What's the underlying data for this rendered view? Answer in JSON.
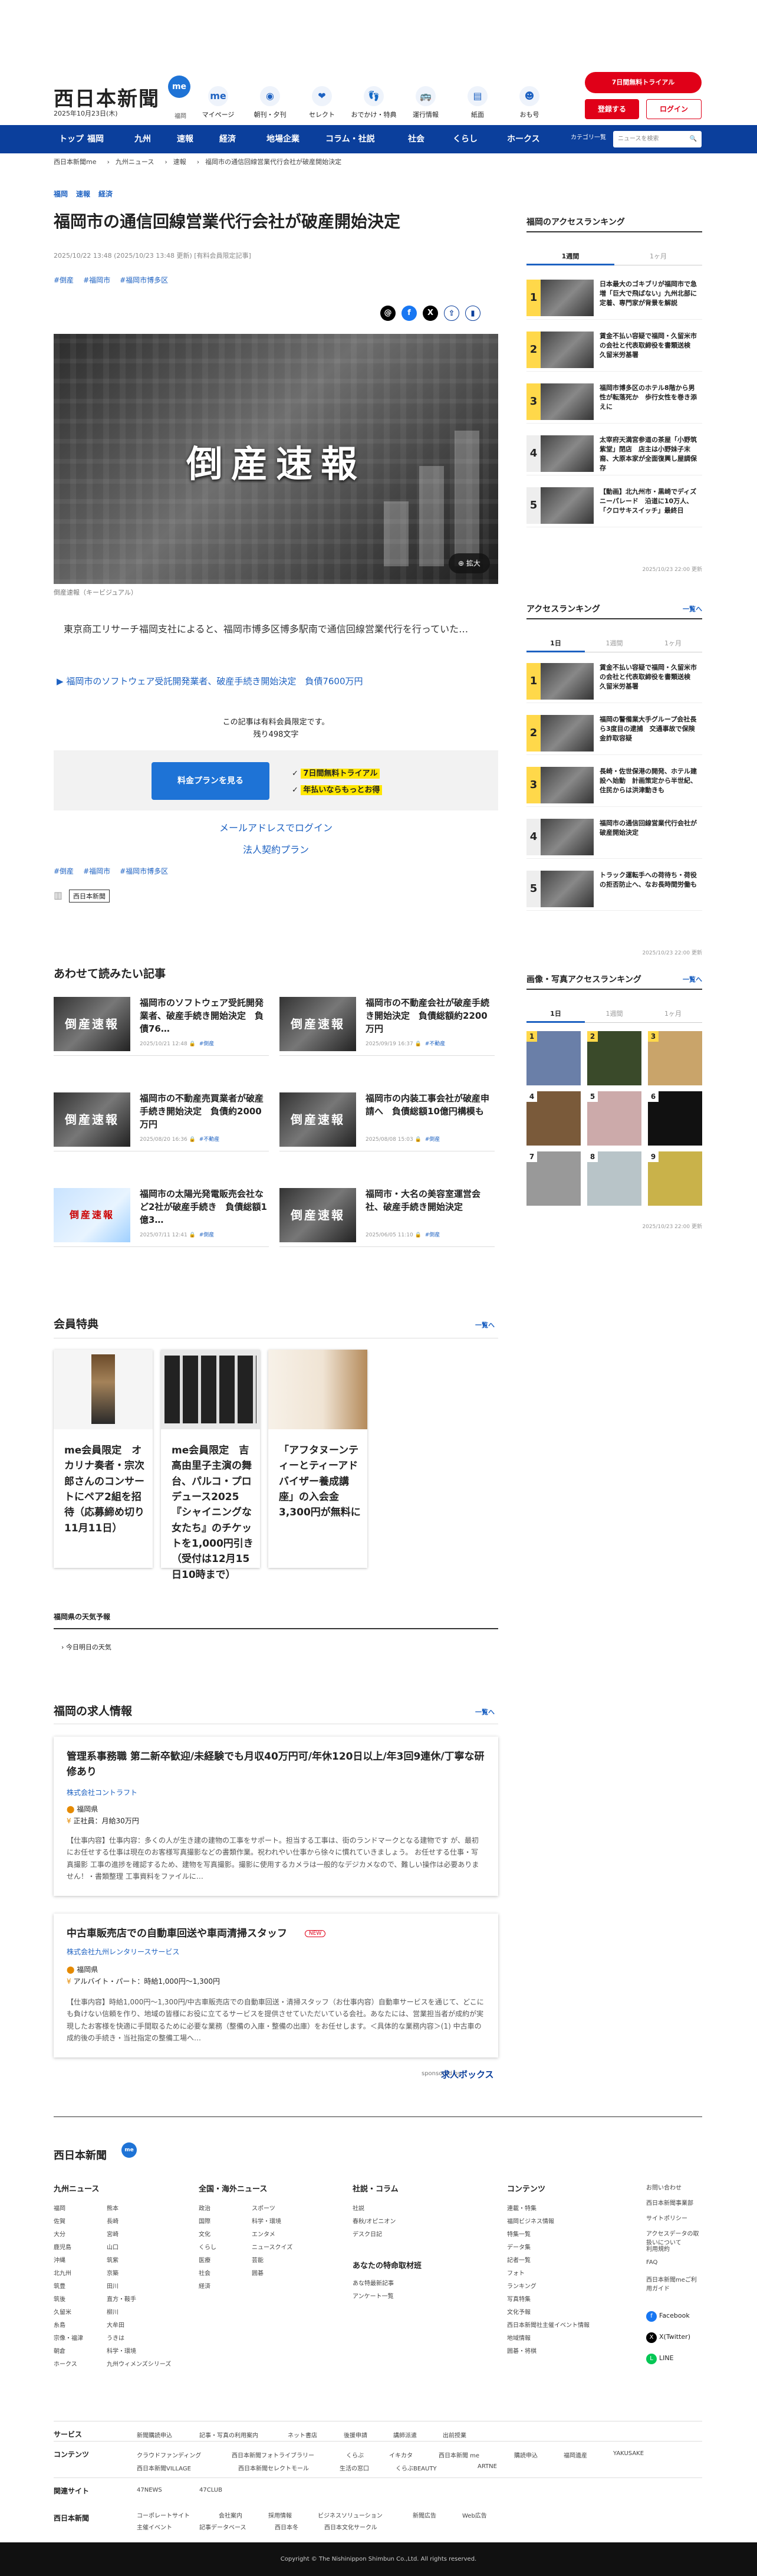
{
  "header": {
    "logo": "西日本新聞",
    "logo_me": "me",
    "date": "2025年10月23日(木)",
    "region": "福岡",
    "nav": [
      {
        "label": "マイページ",
        "icon": "me"
      },
      {
        "label": "朝刊・夕刊",
        "icon": "◉"
      },
      {
        "label": "セレクト",
        "icon": "❤"
      },
      {
        "label": "おでかけ・特典",
        "icon": "👣"
      },
      {
        "label": "運行情報",
        "icon": "🚌"
      },
      {
        "label": "紙面",
        "icon": "▤"
      },
      {
        "label": "おも号",
        "icon": "☻"
      }
    ],
    "trial": "7日間無料トライアル",
    "register": "登録する",
    "login": "ログイン"
  },
  "navbar": {
    "items": [
      "トップ",
      "福岡",
      "九州",
      "速報",
      "経済",
      "地場企業",
      "コラム・社説",
      "社会",
      "くらし",
      "ホークス"
    ],
    "category": "カテゴリ一覧",
    "search_placeholder": "ニュースを検索",
    "search_icon": "🔍"
  },
  "breadcrumb": [
    "西日本新聞me",
    "九州ニュース",
    "速報",
    "福岡市の通信回線営業代行会社が破産開始決定"
  ],
  "article": {
    "top_tags": [
      "福岡",
      "速報",
      "経済"
    ],
    "title": "福岡市の通信回線営業代行会社が破産開始決定",
    "dateline": "2025/10/22 13:48 (2025/10/23 13:48 更新) [有料会員限定記事]",
    "hashtags": [
      "#倒産",
      "#福岡市",
      "#福岡市博多区"
    ],
    "share": [
      {
        "name": "threads",
        "g": "@"
      },
      {
        "name": "facebook",
        "g": "f"
      },
      {
        "name": "x",
        "g": "X"
      },
      {
        "name": "share",
        "g": "⇪"
      },
      {
        "name": "bookmark",
        "g": "▮"
      }
    ],
    "hero_text": "倒産速報",
    "zoom": "拡大",
    "caption": "倒産速報（キービジュアル）",
    "lead": "東京商工リサーチ福岡支社によると、福岡市博多区博多駅南で通信回線営業代行を行っていた…",
    "related_link": "福岡市のソフトウェア受託開発業者、破産手続き開始決定　負債7600万円",
    "members_only": "この記事は有料会員限定です。",
    "remaining": "残り498文字",
    "plan_button": "料金プランを見る",
    "perks": [
      "7日間無料トライアル",
      "年払いならもっとお得"
    ],
    "email_login": "メールアドレスでログイン",
    "corp_plan": "法人契約プラン",
    "bottom_hashtags": [
      "#倒産",
      "#福岡市",
      "#福岡市博多区"
    ],
    "publisher": "西日本新聞"
  },
  "read_also": {
    "heading": "あわせて読みたい記事",
    "items": [
      {
        "title": "福岡市のソフトウェア受託開発業者、破産手続き開始決定　負債76…",
        "date": "2025/10/21 12:48",
        "tag": "#倒産",
        "thumb": "倒産速報"
      },
      {
        "title": "福岡市の不動産会社が破産手続き開始決定　負債総額約2200万円",
        "date": "2025/09/19 16:37",
        "tag": "#不動産",
        "thumb": "倒産速報"
      },
      {
        "title": "福岡市の不動産売買業者が破産手続き開始決定　負債約2000万円",
        "date": "2025/08/20 16:36",
        "tag": "#不動産",
        "thumb": "倒産速報"
      },
      {
        "title": "福岡市の内装工事会社が破産申請へ　負債総額10億円構模も",
        "date": "2025/08/08 15:03",
        "tag": "#倒産",
        "thumb": "倒産速報"
      },
      {
        "title": "福岡市の太陽光発電販売会社など2社が破産手続き　負債総額1億3…",
        "date": "2025/07/11 12:41",
        "tag": "#倒産",
        "thumb": "倒産速報"
      },
      {
        "title": "福岡市・大名の美容室運営会社、破産手続き開始決定",
        "date": "2025/06/05 11:10",
        "tag": "#倒産",
        "thumb": "倒産速報"
      }
    ]
  },
  "member_perks": {
    "heading": "会員特典",
    "more": "一覧へ",
    "items": [
      {
        "title": "me会員限定　オカリナ奏者・宗次郎さんのコンサートにペア2組を招待（応募締め切り11月11日）"
      },
      {
        "title": "me会員限定　吉高由里子主演の舞台、パルコ・プロデュース2025『シャイニングな女たち』のチケットを1,000円引き（受付は12月15日10時まで）"
      },
      {
        "title": "「アフタヌーンティーとティーアドバイザー養成講座」の入会金3,300円が無料に"
      }
    ]
  },
  "weather": {
    "heading": "福岡県の天気予報",
    "tab": "今日明日の天気"
  },
  "jobs": {
    "heading": "福岡の求人情報",
    "more": "一覧へ",
    "items": [
      {
        "title": "管理系事務職 第二新卒歓迎/未経験でも月収40万円可/年休120日以上/年3回9連休/丁寧な研修あり",
        "company": "株式会社コントラフト",
        "location": "福岡県",
        "salary": "正社員：月給30万円",
        "desc": "【仕事内容】仕事内容：多くの人が生き建の建物の工事をサポート。担当する工事は、街のランドマークとなる建物です が、最初にお任せする仕事は現在のお客様写真撮影などの書類作業。祝われやい仕事から徐々に慣れていきましょう。 お任せする仕事・写真撮影 工事の進捗を確認するため、建物を写真撮影。撮影に使用するカメラは一般的なデジカメなので、難しい操作は必要ありません！・書類整理 工事資料をファイルに…"
      },
      {
        "title": "中古車販売店での自動車回送や車両清掃スタッフ",
        "new": "NEW",
        "company": "株式会社九州レンタリースサービス",
        "location": "福岡県",
        "salary": "アルバイト・パート：時給1,000円〜1,300円",
        "desc": "【仕事内容】時給1,000円〜1,300円/中古車販売店での自動車回送・清掃スタッフ（お仕事内容）自動車サービスを通じて、どこにも負けない信頼を作り、地域の皆様にお役に立てるサービスを提供させていただいている会社。あなたには、営業担当者が成約が実現したお客様を快適に手間取るために必要な業務（整備の入庫・整備の出庫）をお任せします。＜具体的な業務内容＞(1) 中古車の成約後の手続き・当社指定の整備工場へ…"
      }
    ],
    "powered": "sponsored by",
    "kyujin": "求人ボックス"
  },
  "sidebar": {
    "access_ranking_fukuoka": {
      "heading": "福岡のアクセスランキング",
      "tabs": [
        "1週間",
        "1ヶ月"
      ],
      "items": [
        {
          "rank": "1",
          "title": "日本最大のゴキブリが福岡市で急増「巨大で飛ばない」九州北部に定着、専門家が背景を解説"
        },
        {
          "rank": "2",
          "title": "賃金不払い容疑で福岡・久留米市の会社と代表取締役を書類送検　久留米労基署"
        },
        {
          "rank": "3",
          "title": "福岡市博多区のホテル8階から男性が転落死か　歩行女性を巻き添えに"
        },
        {
          "rank": "4",
          "title": "太宰府天満宮参道の茶屋「小野筑紫堂」閉店　店主は小野妹子末裔、大原本家が全面復興し屋調保存"
        },
        {
          "rank": "5",
          "title": "【動画】北九州市・黒崎でディズニーパレード　沿道に10万人、「クロサキスイッチ」最終日"
        }
      ],
      "updated": "2025/10/23 22:00 更新"
    },
    "access_ranking": {
      "heading": "アクセスランキング",
      "more": "一覧へ",
      "tabs": [
        "1日",
        "1週間",
        "1ヶ月"
      ],
      "items": [
        {
          "rank": "1",
          "title": "賃金不払い容疑で福岡・久留米市の会社と代表取締役を書類送検　久留米労基署"
        },
        {
          "rank": "2",
          "title": "福岡の警備業大手グループ会社長ら3度目の逮捕　交通事故で保険金詐取容疑"
        },
        {
          "rank": "3",
          "title": "長崎・佐世保港の開発、ホテル建設へ始動　計画策定から半世紀、住民からは洪津動きも"
        },
        {
          "rank": "4",
          "title": "福岡市の通信回線営業代行会社が破産開始決定"
        },
        {
          "rank": "5",
          "title": "トラック運転手への荷待ち・荷役の拒否防止へ、なお長時間労働も"
        }
      ],
      "updated": "2025/10/23 22:00 更新"
    },
    "photo_ranking": {
      "heading": "画像・写真アクセスランキング",
      "more": "一覧へ",
      "tabs": [
        "1日",
        "1週間",
        "1ヶ月"
      ],
      "ranks": [
        "1",
        "2",
        "3",
        "4",
        "5",
        "6",
        "7",
        "8",
        "9"
      ],
      "updated": "2025/10/23 22:00 更新"
    }
  },
  "footer": {
    "logo": "西日本新聞",
    "me": "me",
    "cols": [
      {
        "heading": "九州ニュース",
        "links": [
          "福岡",
          "佐賀",
          "大分",
          "鹿児島",
          "沖縄",
          "北九州",
          "筑豊",
          "筑後",
          "久留米",
          "糸島",
          "宗像・福津",
          "朝倉",
          "ホークス",
          "熊本",
          "長崎",
          "宮崎",
          "山口",
          "筑紫",
          "京築",
          "田川",
          "直方・鞍手",
          "柳川",
          "大牟田",
          "うきは",
          "科学・環境",
          "九州ウィメンズシリーズ"
        ]
      },
      {
        "heading": "全国・海外ニュース",
        "links": [
          "政治",
          "国際",
          "文化",
          "くらし",
          "医療",
          "社会",
          "経済",
          "スポーツ",
          "科学・環境",
          "エンタメ",
          "ニュースクイズ",
          "芸能",
          "囲碁"
        ]
      },
      {
        "heading": "社説・コラム",
        "links": [
          "社説",
          "春秋/オピニオン",
          "デスク日記"
        ],
        "sub": "あなたの特命取材班",
        "sub_links": [
          "あな特最新記事",
          "アンケート一覧"
        ]
      },
      {
        "heading": "コンテンツ",
        "links": [
          "連載・特集",
          "福岡ビジネス情報",
          "特集一覧",
          "データ集",
          "記者一覧",
          "フォト",
          "ランキング",
          "写真特集",
          "文化予報",
          "西日本新聞社主催イベント情報",
          "地域情報",
          "囲碁・将棋"
        ]
      }
    ],
    "misc": [
      "お問い合わせ",
      "西日本新聞事業部",
      "サイトポリシー",
      "アクセスデータの取扱いについて",
      "利用規約",
      "FAQ",
      "西日本新聞meご利用ガイド"
    ],
    "sns": [
      {
        "label": "Facebook",
        "g": "f",
        "c": "#1877f2"
      },
      {
        "label": "X(Twitter)",
        "g": "X",
        "c": "#000"
      },
      {
        "label": "LINE",
        "g": "L",
        "c": "#06c755"
      }
    ],
    "service": {
      "heading": "サービス",
      "links": [
        "新聞購読申込",
        "記事・写真の利用案内",
        "ネット書店",
        "後援申請",
        "講師派遣",
        "出前授業"
      ]
    },
    "contents": {
      "heading": "コンテンツ",
      "links": [
        "クラウドファンディング",
        "西日本新聞フォトライブラリー",
        "くらぶ",
        "イキカタ",
        "西日本新聞 me",
        "購読申込",
        "福岡遺産",
        "YAKUSAKE",
        "西日本新聞VILLAGE",
        "西日本新聞セレクトモール",
        "生活の窓口",
        "くらぶBEAUTY",
        "ARTNE"
      ]
    },
    "related": {
      "heading": "関連サイト",
      "links": [
        "47NEWS",
        "47CLUB"
      ]
    },
    "bottom_logo": "西日本新聞",
    "bottom_links": [
      "コーポレートサイト",
      "会社案内",
      "採用情報",
      "ビジネスソリューション",
      "新聞広告",
      "Web広告",
      "主催イベント",
      "記事データベース",
      "西日本冬",
      "西日本文化サークル"
    ],
    "copyright": "Copyright © The Nishinippon Shimbun Co.,Ltd. All rights reserved."
  }
}
